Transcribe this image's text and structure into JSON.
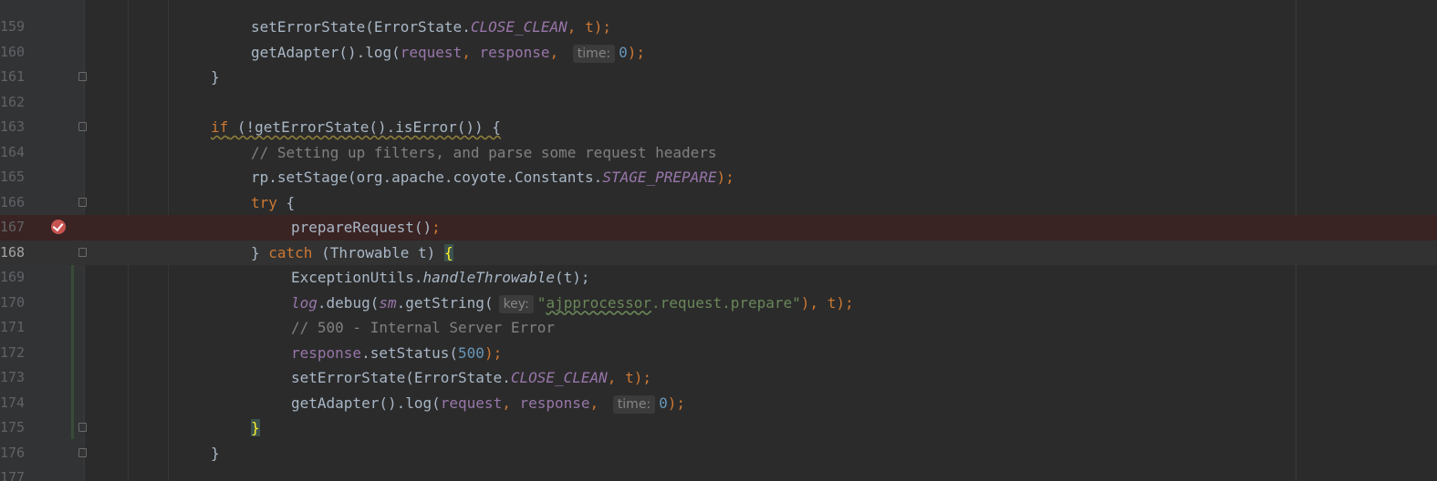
{
  "colors": {
    "background": "#2b2b2b",
    "gutter": "#313335",
    "keyword": "#cc7832",
    "field": "#9876aa",
    "number": "#6897bb",
    "string": "#6a8759",
    "comment": "#808080",
    "breakpoint": "#c75450"
  },
  "line_numbers": {
    "l159": "159",
    "l160": "160",
    "l161": "161",
    "l162": "162",
    "l163": "163",
    "l164": "164",
    "l165": "165",
    "l166": "166",
    "l167": "167",
    "l168": "168",
    "l169": "169",
    "l170": "170",
    "l171": "171",
    "l172": "172",
    "l173": "173",
    "l174": "174",
    "l175": "175",
    "l176": "176",
    "l177": "177"
  },
  "code": {
    "l159": {
      "a": "setErrorState(ErrorState.",
      "b": "CLOSE_CLEAN",
      "c": ", t);"
    },
    "l160": {
      "a": "getAdapter().log(",
      "b": "request",
      "c": ", ",
      "d": "response",
      "e": ", ",
      "hint": "time:",
      "f": "0",
      "g": ");"
    },
    "l161": {
      "a": "}"
    },
    "l163": {
      "a": "if",
      "b": " (!getErrorState().isError()) {"
    },
    "l164": {
      "a": "// Setting up filters, and parse some request headers"
    },
    "l165": {
      "a": "rp.setStage(org.apache.coyote.Constants.",
      "b": "STAGE_PREPARE",
      "c": ");"
    },
    "l166": {
      "a": "try",
      "b": " {"
    },
    "l167": {
      "a": "prepareRequest()",
      "b": ";"
    },
    "l168": {
      "a": "} ",
      "b": "catch",
      "c": " (Throwable t) ",
      "d": "{"
    },
    "l169": {
      "a": "ExceptionUtils.",
      "b": "handleThrowable",
      "c": "(t);"
    },
    "l170": {
      "a": "log",
      "b": ".debug(",
      "c": "sm",
      "d": ".getString(",
      "hint": "key:",
      "e": "\"",
      "f": "ajpprocessor",
      "g": ".request.prepare\"",
      "h": "), t);"
    },
    "l171": {
      "a": "// 500 - Internal Server Error"
    },
    "l172": {
      "a": "response",
      "b": ".setStatus(",
      "c": "500",
      "d": ");"
    },
    "l173": {
      "a": "setErrorState(ErrorState.",
      "b": "CLOSE_CLEAN",
      "c": ", t);"
    },
    "l174": {
      "a": "getAdapter().log(",
      "b": "request",
      "c": ", ",
      "d": "response",
      "e": ", ",
      "hint": "time:",
      "f": "0",
      "g": ");"
    },
    "l175": {
      "a": "}"
    },
    "l176": {
      "a": "}"
    }
  },
  "icons": {
    "breakpoint": "breakpoint-icon",
    "fold": "fold-marker-icon"
  }
}
